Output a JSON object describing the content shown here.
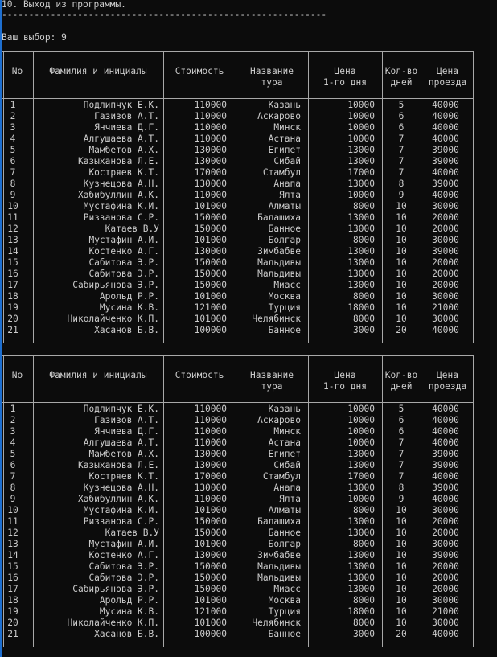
{
  "console": {
    "menu_exit": "10. Выход из программы.",
    "separator": "------------------------------------------------------------",
    "prompt": "Ваш выбор: 9"
  },
  "table": {
    "headers": [
      [
        "No"
      ],
      [
        "Фамилия и инициалы"
      ],
      [
        "Стоимость"
      ],
      [
        "Название",
        "тура"
      ],
      [
        "Цена",
        "1-го дня"
      ],
      [
        "Кол-во",
        "дней"
      ],
      [
        "Цена",
        "проезда"
      ]
    ],
    "rows": [
      [
        "1",
        "Подлипчук Е.К.",
        "110000",
        "Казань",
        "10000",
        "5",
        "40000"
      ],
      [
        "2",
        "Газизов А.Т.",
        "110000",
        "Аскарово",
        "10000",
        "6",
        "40000"
      ],
      [
        "3",
        "Янчиева Д.Г.",
        "110000",
        "Минск",
        "10000",
        "6",
        "40000"
      ],
      [
        "4",
        "Алгушаева А.Т.",
        "110000",
        "Астана",
        "10000",
        "7",
        "40000"
      ],
      [
        "5",
        "Мамбетов А.Х.",
        "130000",
        "Египет",
        "13000",
        "7",
        "39000"
      ],
      [
        "6",
        "Казыханова Л.Е.",
        "130000",
        "Сибай",
        "13000",
        "7",
        "39000"
      ],
      [
        "7",
        "Костряев К.Т.",
        "170000",
        "Стамбул",
        "17000",
        "7",
        "40000"
      ],
      [
        "8",
        "Кузнецова А.Н.",
        "130000",
        "Анапа",
        "13000",
        "8",
        "39000"
      ],
      [
        "9",
        "Хабибуллин А.К.",
        "110000",
        "Ялта",
        "10000",
        "9",
        "40000"
      ],
      [
        "10",
        "Мустафина К.И.",
        "101000",
        "Алматы",
        "8000",
        "10",
        "30000"
      ],
      [
        "11",
        "Ризванова С.Р.",
        "150000",
        "Балашиха",
        "13000",
        "10",
        "20000"
      ],
      [
        "12",
        "Катаев В.У",
        "150000",
        "Банное",
        "13000",
        "10",
        "20000"
      ],
      [
        "13",
        "Мустафин А.И.",
        "101000",
        "Болгар",
        "8000",
        "10",
        "30000"
      ],
      [
        "14",
        "Костенко А.Г.",
        "130000",
        "Зимбабве",
        "13000",
        "10",
        "39000"
      ],
      [
        "15",
        "Сабитова Э.Р.",
        "150000",
        "Мальдивы",
        "13000",
        "10",
        "20000"
      ],
      [
        "16",
        "Сабитова Э.Р.",
        "150000",
        "Мальдивы",
        "13000",
        "10",
        "20000"
      ],
      [
        "17",
        "Сабирьянова Э.Р.",
        "150000",
        "Миасс",
        "13000",
        "10",
        "20000"
      ],
      [
        "18",
        "Арольд Р.Р.",
        "101000",
        "Москва",
        "8000",
        "10",
        "30000"
      ],
      [
        "19",
        "Мусина К.В.",
        "121000",
        "Турция",
        "18000",
        "10",
        "21000"
      ],
      [
        "20",
        "Николайченко К.П.",
        "101000",
        "Челябинск",
        "8000",
        "10",
        "30000"
      ],
      [
        "21",
        "Хасанов Б.В.",
        "100000",
        "Банное",
        "3000",
        "20",
        "40000"
      ]
    ]
  },
  "colors": {
    "background": "#0c0c0c",
    "text": "#cccccc",
    "border": "#a8a8a8",
    "window_edge": "#1e6fd0"
  }
}
